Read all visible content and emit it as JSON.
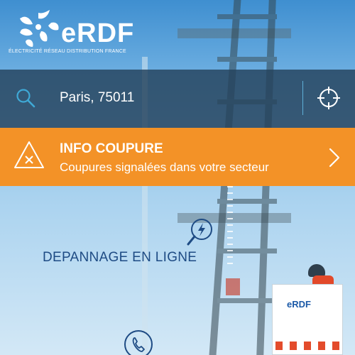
{
  "brand": {
    "name": "eRDF",
    "tagline": "ÉLECTRICITÉ RÉSEAU DISTRIBUTION FRANCE"
  },
  "search": {
    "value": "Paris, 75011",
    "icon": "search-icon",
    "locate_icon": "crosshair-icon"
  },
  "alert": {
    "title": "INFO COUPURE",
    "subtitle": "Coupures signalées dans votre secteur",
    "icon": "warning-triangle-icon"
  },
  "menu": {
    "items": [
      {
        "label": "DEPANNAGE EN LIGNE",
        "icon": "repair-icon"
      },
      {
        "label": "",
        "icon": "phone-icon"
      }
    ]
  },
  "colors": {
    "alert_orange": "#f39227",
    "searchbar": "#24425c",
    "accent_blue": "#1e4b84",
    "search_icon": "#3fa9d6"
  }
}
